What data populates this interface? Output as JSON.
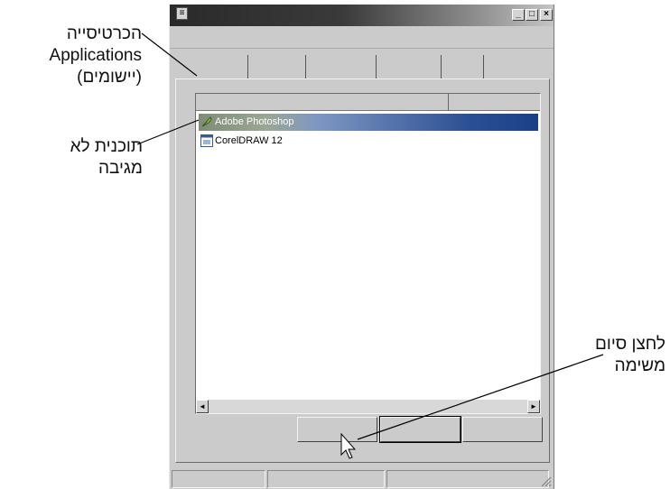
{
  "window": {
    "caption_buttons": [
      "_",
      "□",
      "×"
    ],
    "tabs_count": 6,
    "list_items": [
      {
        "name": "Adobe Photoshop",
        "selected": true,
        "icon": "feather-icon"
      },
      {
        "name": "CorelDRAW 12",
        "selected": false,
        "icon": "app-window-icon"
      }
    ],
    "scroll_left": "◄",
    "scroll_right": "►"
  },
  "callouts": {
    "applications_tab": [
      "הכרטיסייה",
      "Applications",
      "(יישומים)"
    ],
    "not_responding": [
      "תוכנית לא",
      "מגיבה"
    ],
    "end_task_button": [
      "לחצן סיום",
      "משימה"
    ]
  },
  "colors": {
    "window_bg": "#cbcbcb",
    "selection_start": "#8a9a85",
    "selection_end": "#1c3f88"
  }
}
